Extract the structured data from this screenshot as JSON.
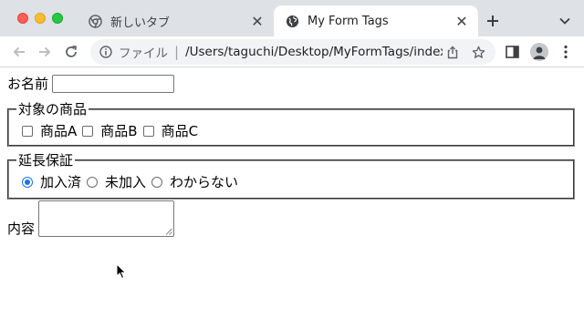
{
  "tabs": [
    {
      "title": "新しいタブ",
      "active": false,
      "icon": "chrome-icon"
    },
    {
      "title": "My Form Tags",
      "active": true,
      "icon": "globe-icon"
    }
  ],
  "toolbar": {
    "scheme_label": "ファイル",
    "url": "/Users/taguchi/Desktop/MyFormTags/index.html"
  },
  "form": {
    "name_label": "お名前",
    "name_value": "",
    "products": {
      "legend": "対象の商品",
      "options": [
        {
          "label": "商品A",
          "checked": false
        },
        {
          "label": "商品B",
          "checked": false
        },
        {
          "label": "商品C",
          "checked": false
        }
      ]
    },
    "warranty": {
      "legend": "延長保証",
      "options": [
        {
          "label": "加入済",
          "checked": true
        },
        {
          "label": "未加入",
          "checked": false
        },
        {
          "label": "わからない",
          "checked": false
        }
      ]
    },
    "content_label": "内容",
    "content_value": ""
  },
  "colors": {
    "accent": "#1a73e8",
    "tabstrip": "#dee1e6",
    "close": "#ff5f57",
    "minimize": "#febc2e",
    "maximize": "#28c840"
  }
}
